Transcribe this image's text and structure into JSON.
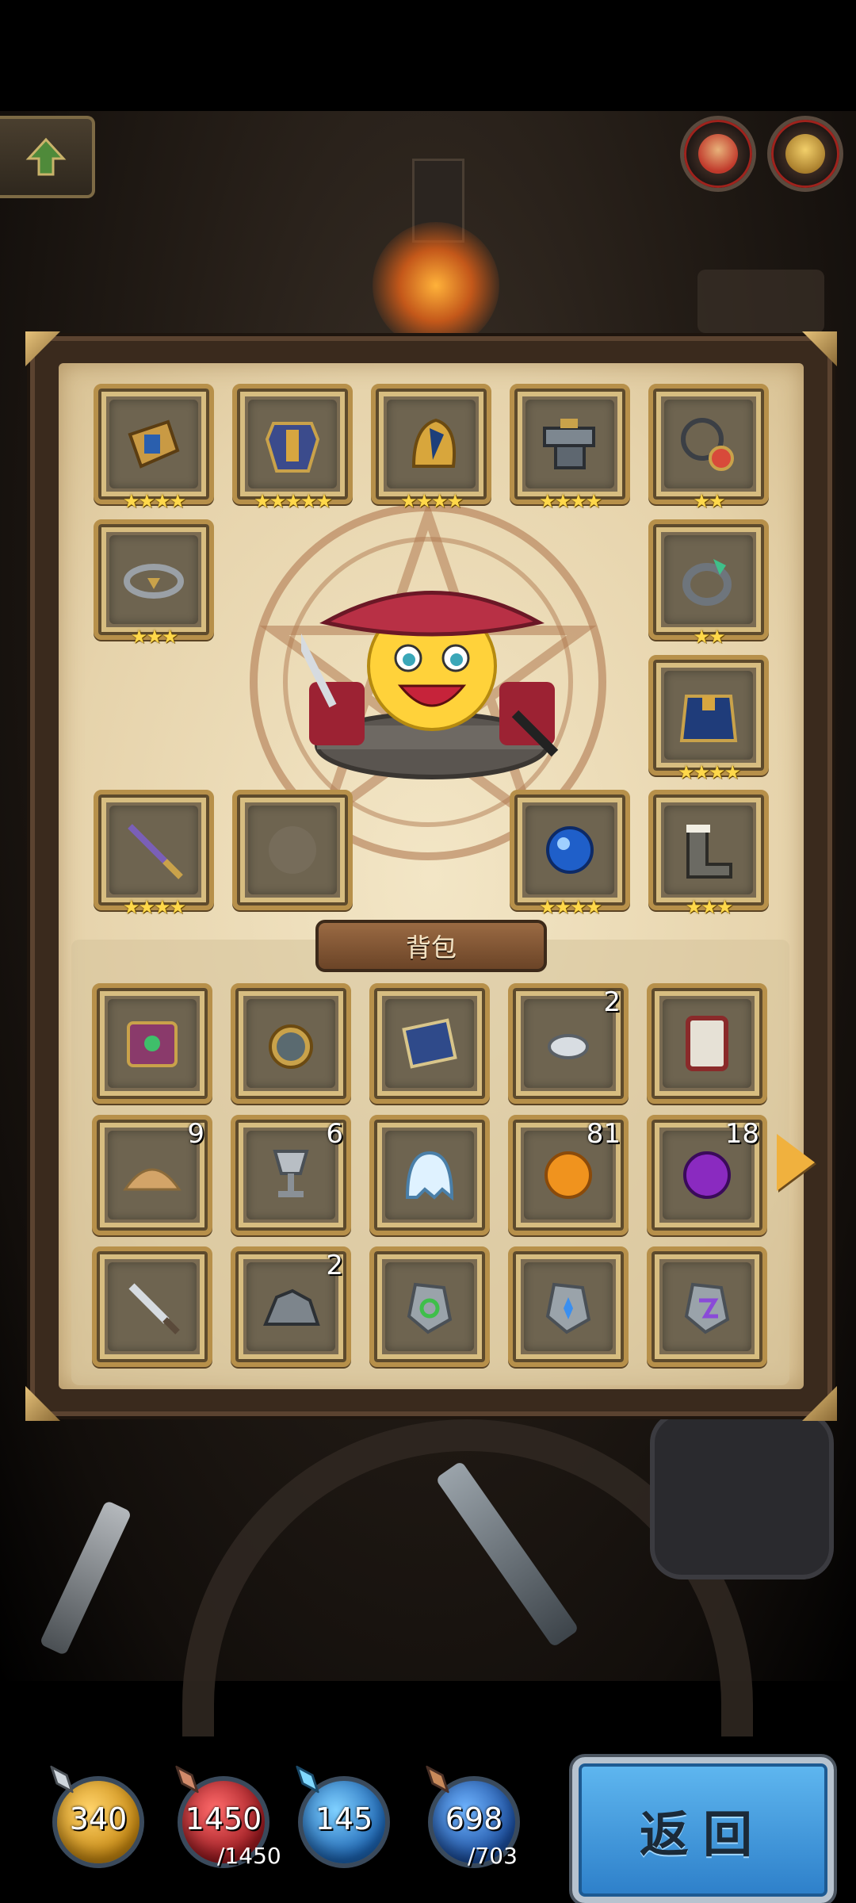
{
  "header": {
    "back_icon": "up-arrow-icon",
    "avatars": [
      {
        "name": "red-hero-avatar",
        "color": "#c0392b"
      },
      {
        "name": "yellow-hero-avatar",
        "color": "#d8a640"
      }
    ]
  },
  "equipment": [
    {
      "id": "bracer",
      "icon": "bracer-icon",
      "stars": "★★★★"
    },
    {
      "id": "chest-armor",
      "icon": "chest-armor-icon",
      "stars": "★★★★★"
    },
    {
      "id": "winged-helmet",
      "icon": "winged-helmet-icon",
      "stars": "★★★★"
    },
    {
      "id": "anvil",
      "icon": "anvil-icon",
      "stars": "★★★★"
    },
    {
      "id": "amulet",
      "icon": "amulet-icon",
      "stars": "★★"
    },
    {
      "id": "crown",
      "icon": "crown-icon",
      "stars": "★★★"
    },
    {
      "id": "ring",
      "icon": "ring-icon",
      "stars": "★★"
    },
    {
      "id": "cape",
      "icon": "cape-icon",
      "stars": "★★★★"
    },
    {
      "id": "katana",
      "icon": "katana-icon",
      "stars": "★★★★"
    },
    {
      "id": "empty-slot",
      "icon": "empty-mask-icon",
      "stars": ""
    },
    {
      "id": "blue-orb",
      "icon": "blue-orb-icon",
      "stars": "★★★★"
    },
    {
      "id": "boots",
      "icon": "boots-icon",
      "stars": "★★★"
    }
  ],
  "bag": {
    "title": "背包",
    "items": [
      {
        "icon": "spellbook-icon",
        "count": ""
      },
      {
        "icon": "compass-icon",
        "count": ""
      },
      {
        "icon": "scroll-icon",
        "count": ""
      },
      {
        "icon": "silver-nugget-icon",
        "count": "2"
      },
      {
        "icon": "card-icon",
        "count": ""
      },
      {
        "icon": "sand-pile-icon",
        "count": "9"
      },
      {
        "icon": "goblet-icon",
        "count": "6"
      },
      {
        "icon": "ghost-icon",
        "count": ""
      },
      {
        "icon": "orange-orb-icon",
        "count": "81"
      },
      {
        "icon": "purple-orb-icon",
        "count": "18"
      },
      {
        "icon": "sword-icon",
        "count": ""
      },
      {
        "icon": "ore-icon",
        "count": "2"
      },
      {
        "icon": "green-rune-stone-icon",
        "count": ""
      },
      {
        "icon": "blue-rune-stone-icon",
        "count": ""
      },
      {
        "icon": "purple-rune-stone-icon",
        "count": ""
      }
    ],
    "next_icon": "next-page-arrow-icon"
  },
  "resources": [
    {
      "name": "attack",
      "value": "340",
      "max": "",
      "color": "#e0a020"
    },
    {
      "name": "health",
      "value": "1450",
      "max": "/1450",
      "color": "#c0282e"
    },
    {
      "name": "defense",
      "value": "145",
      "max": "",
      "color": "#2a8fd8"
    },
    {
      "name": "mana",
      "value": "698",
      "max": "/703",
      "color": "#2e6fc0"
    }
  ],
  "return_button": "返回"
}
